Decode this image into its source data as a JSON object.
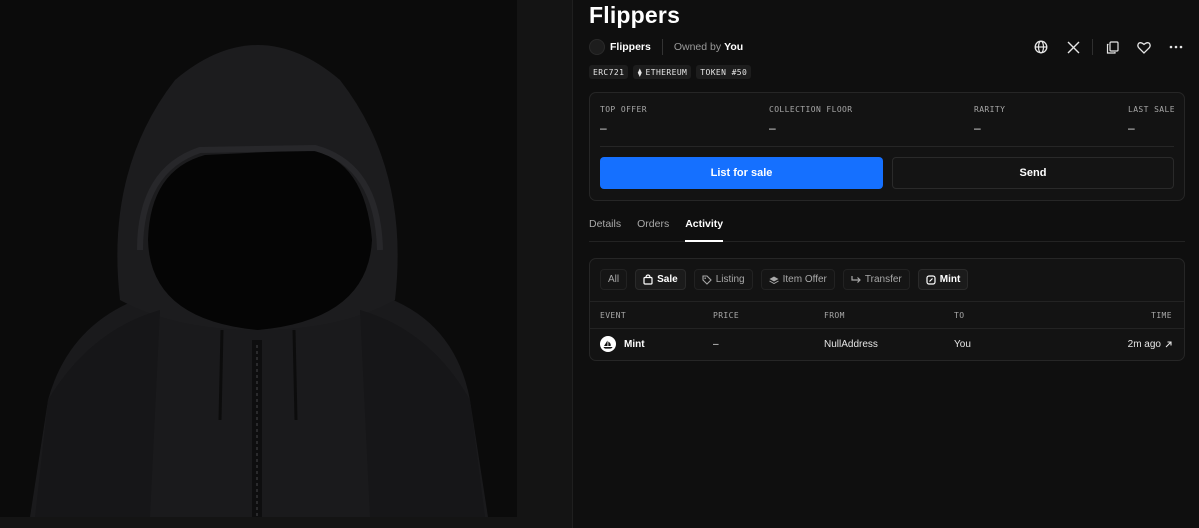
{
  "nft": {
    "title": "Flippers",
    "collection_name": "Flippers",
    "owned_by_label": "Owned by",
    "owner": "You",
    "chips": [
      "ERC721",
      "ETHEREUM",
      "TOKEN #50"
    ]
  },
  "header_actions": [
    "globe-icon",
    "x-icon",
    "copy-icon",
    "heart-icon",
    "more-icon"
  ],
  "stats": [
    {
      "label": "TOP OFFER",
      "value": "–"
    },
    {
      "label": "COLLECTION FLOOR",
      "value": "–"
    },
    {
      "label": "RARITY",
      "value": "–"
    },
    {
      "label": "LAST SALE",
      "value": "–"
    }
  ],
  "actions": {
    "list_label": "List for sale",
    "send_label": "Send"
  },
  "tabs": [
    {
      "label": "Details",
      "active": false
    },
    {
      "label": "Orders",
      "active": false
    },
    {
      "label": "Activity",
      "active": true
    }
  ],
  "activity": {
    "filters": [
      {
        "label": "All",
        "icon": "",
        "active": false
      },
      {
        "label": "Sale",
        "icon": "bag-icon",
        "active": true
      },
      {
        "label": "Listing",
        "icon": "tag-icon",
        "active": false
      },
      {
        "label": "Item Offer",
        "icon": "offer-icon",
        "active": false
      },
      {
        "label": "Transfer",
        "icon": "transfer-icon",
        "active": false
      },
      {
        "label": "Mint",
        "icon": "mint-icon",
        "active": true
      }
    ],
    "columns": [
      "EVENT",
      "PRICE",
      "FROM",
      "TO",
      "TIME"
    ],
    "rows": [
      {
        "event": "Mint",
        "price": "–",
        "from": "NullAddress",
        "to": "You",
        "time": "2m ago"
      }
    ]
  },
  "colors": {
    "accent": "#1570ff",
    "background": "#0f0f0f",
    "card": "#131313",
    "muted": "#a8a8a8"
  }
}
